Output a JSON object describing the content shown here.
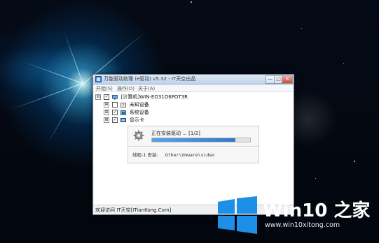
{
  "window": {
    "title": "万能驱动助理 (e驱动) v5.32 - IT天空出品",
    "menu": [
      "开始(S)",
      "操作(O)",
      "关于(A)"
    ],
    "controls": {
      "minimize": "—",
      "maximize": "□",
      "close": "✕"
    }
  },
  "tree": {
    "root": {
      "label": "[计算机]WIN-EO31O6POT3R",
      "expander": "⊟",
      "checked": "✓"
    },
    "children": [
      {
        "label": "未知设备",
        "expander": "⊞",
        "checked": ""
      },
      {
        "label": "系统设备",
        "expander": "⊞",
        "checked": "✓"
      },
      {
        "label": "显示卡",
        "expander": "⊞",
        "checked": "✓"
      }
    ]
  },
  "install": {
    "status": "正在安装驱动 ... [1/2]",
    "progress": 0.85,
    "thread_label": "线程-1 安装:",
    "thread_path": "Other\\Vmware\\video"
  },
  "statusbar": {
    "text": "欢迎访问 IT天空[ITianKong.Com]"
  },
  "watermark": {
    "name": "Win10 之家",
    "url": "www.win10xitong.com"
  },
  "colors": {
    "accent": "#2f79c9",
    "logo_blue": "#1e8fe6"
  }
}
